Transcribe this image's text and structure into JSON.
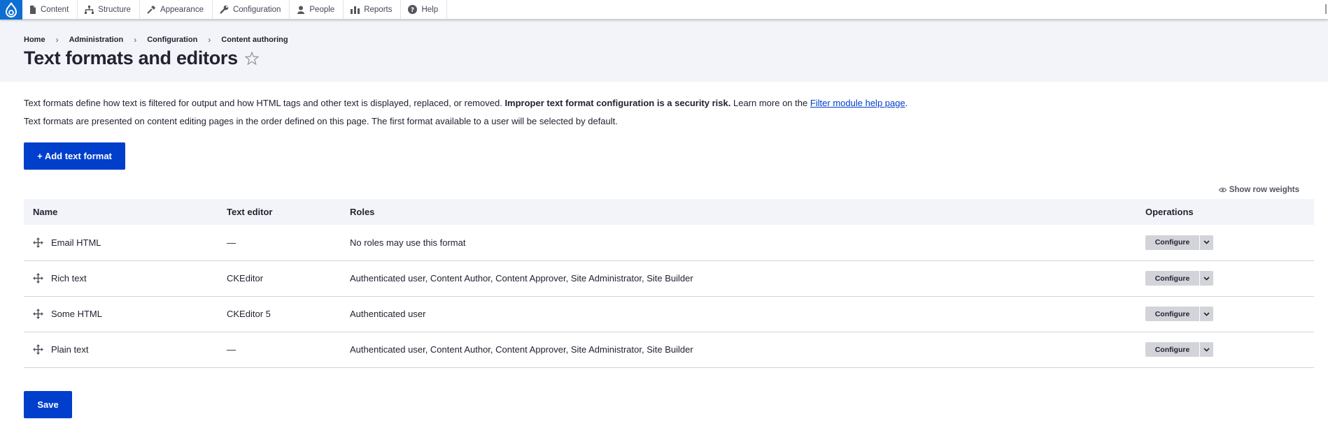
{
  "toolbar": {
    "items": [
      {
        "label": "Content",
        "icon": "file-icon"
      },
      {
        "label": "Structure",
        "icon": "sitemap-icon"
      },
      {
        "label": "Appearance",
        "icon": "brush-icon"
      },
      {
        "label": "Configuration",
        "icon": "wrench-icon"
      },
      {
        "label": "People",
        "icon": "person-icon"
      },
      {
        "label": "Reports",
        "icon": "bar-chart-icon"
      },
      {
        "label": "Help",
        "icon": "help-icon"
      }
    ]
  },
  "breadcrumb": [
    "Home",
    "Administration",
    "Configuration",
    "Content authoring"
  ],
  "breadcrumb_separator": "›",
  "page": {
    "title": "Text formats and editors",
    "star_icon": "star-outline-icon"
  },
  "description": {
    "line1_text": "Text formats define how text is filtered for output and how HTML tags and other text is displayed, replaced, or removed.",
    "line1_bold": "Improper text format configuration is a security risk.",
    "line1_more": "Learn more on the",
    "line1_link": "Filter module help page",
    "line1_end": ".",
    "line2": "Text formats are presented on content editing pages in the order defined on this page. The first format available to a user will be selected by default."
  },
  "add_button_label": "+ Add text format",
  "show_row_weights": "Show row weights",
  "table": {
    "headers": [
      "Name",
      "Text editor",
      "Roles",
      "Operations"
    ],
    "rows": [
      {
        "name": "Email HTML",
        "editor": "—",
        "roles": "No roles may use this format",
        "operation": "Configure"
      },
      {
        "name": "Rich text",
        "editor": "CKEditor",
        "roles": "Authenticated user, Content Author, Content Approver, Site Administrator, Site Builder",
        "operation": "Configure"
      },
      {
        "name": "Some HTML",
        "editor": "CKEditor 5",
        "roles": "Authenticated user",
        "operation": "Configure"
      },
      {
        "name": "Plain text",
        "editor": "—",
        "roles": "Authenticated user, Content Author, Content Approver, Site Administrator, Site Builder",
        "operation": "Configure"
      }
    ]
  },
  "save_label": "Save",
  "colors": {
    "primary": "#003ecc",
    "logo_bg": "#0f6ed1",
    "header_bg": "#f3f4f9",
    "button_secondary": "#d3d4d9",
    "text": "#222330"
  }
}
